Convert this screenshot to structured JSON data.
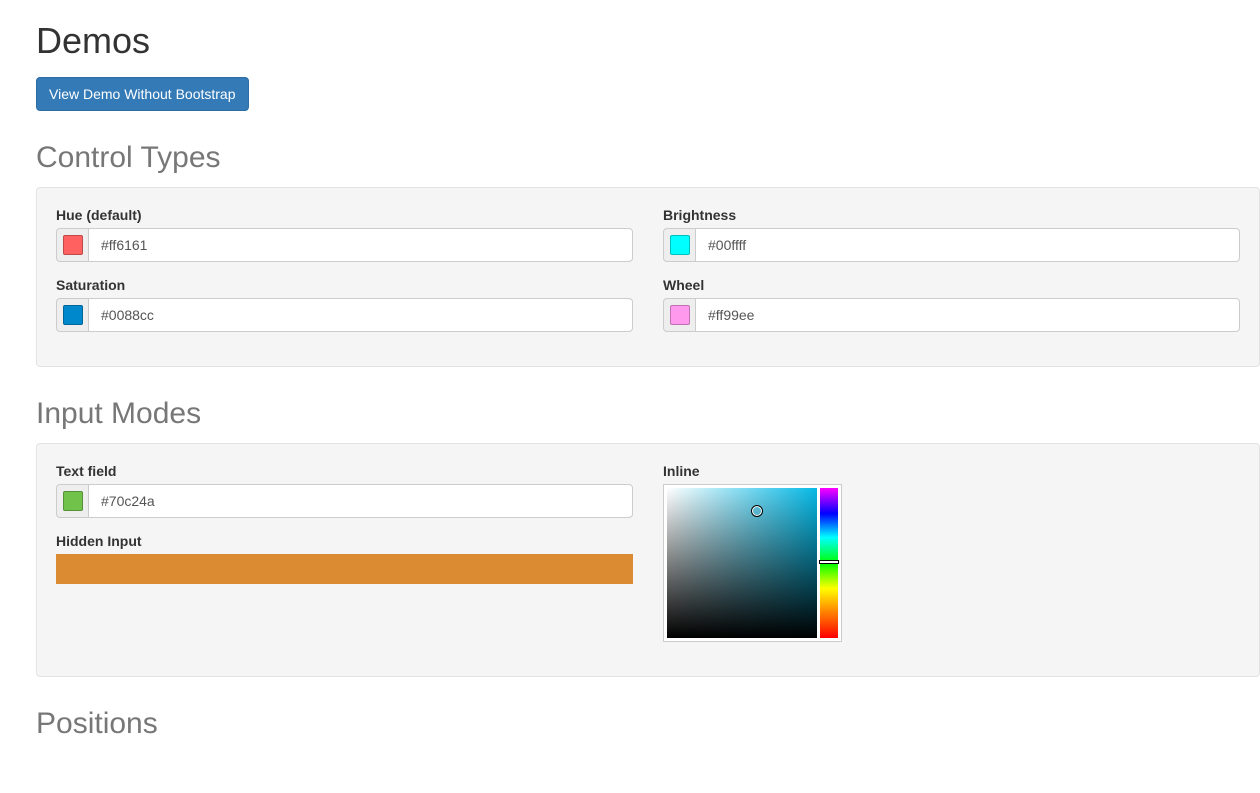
{
  "page": {
    "title": "Demos",
    "demo_button": "View Demo Without Bootstrap"
  },
  "sections": {
    "control_types": "Control Types",
    "input_modes": "Input Modes",
    "positions": "Positions"
  },
  "control_types": {
    "hue": {
      "label": "Hue (default)",
      "value": "#ff6161",
      "swatch": "#ff6161"
    },
    "brightness": {
      "label": "Brightness",
      "value": "#00ffff",
      "swatch": "#00ffff"
    },
    "saturation": {
      "label": "Saturation",
      "value": "#0088cc",
      "swatch": "#0088cc"
    },
    "wheel": {
      "label": "Wheel",
      "value": "#ff99ee",
      "swatch": "#ff99ee"
    }
  },
  "input_modes": {
    "text_field": {
      "label": "Text field",
      "value": "#70c24a",
      "swatch": "#70c24a"
    },
    "hidden_input": {
      "label": "Hidden Input",
      "swatch": "#db8b32"
    },
    "inline": {
      "label": "Inline"
    }
  }
}
